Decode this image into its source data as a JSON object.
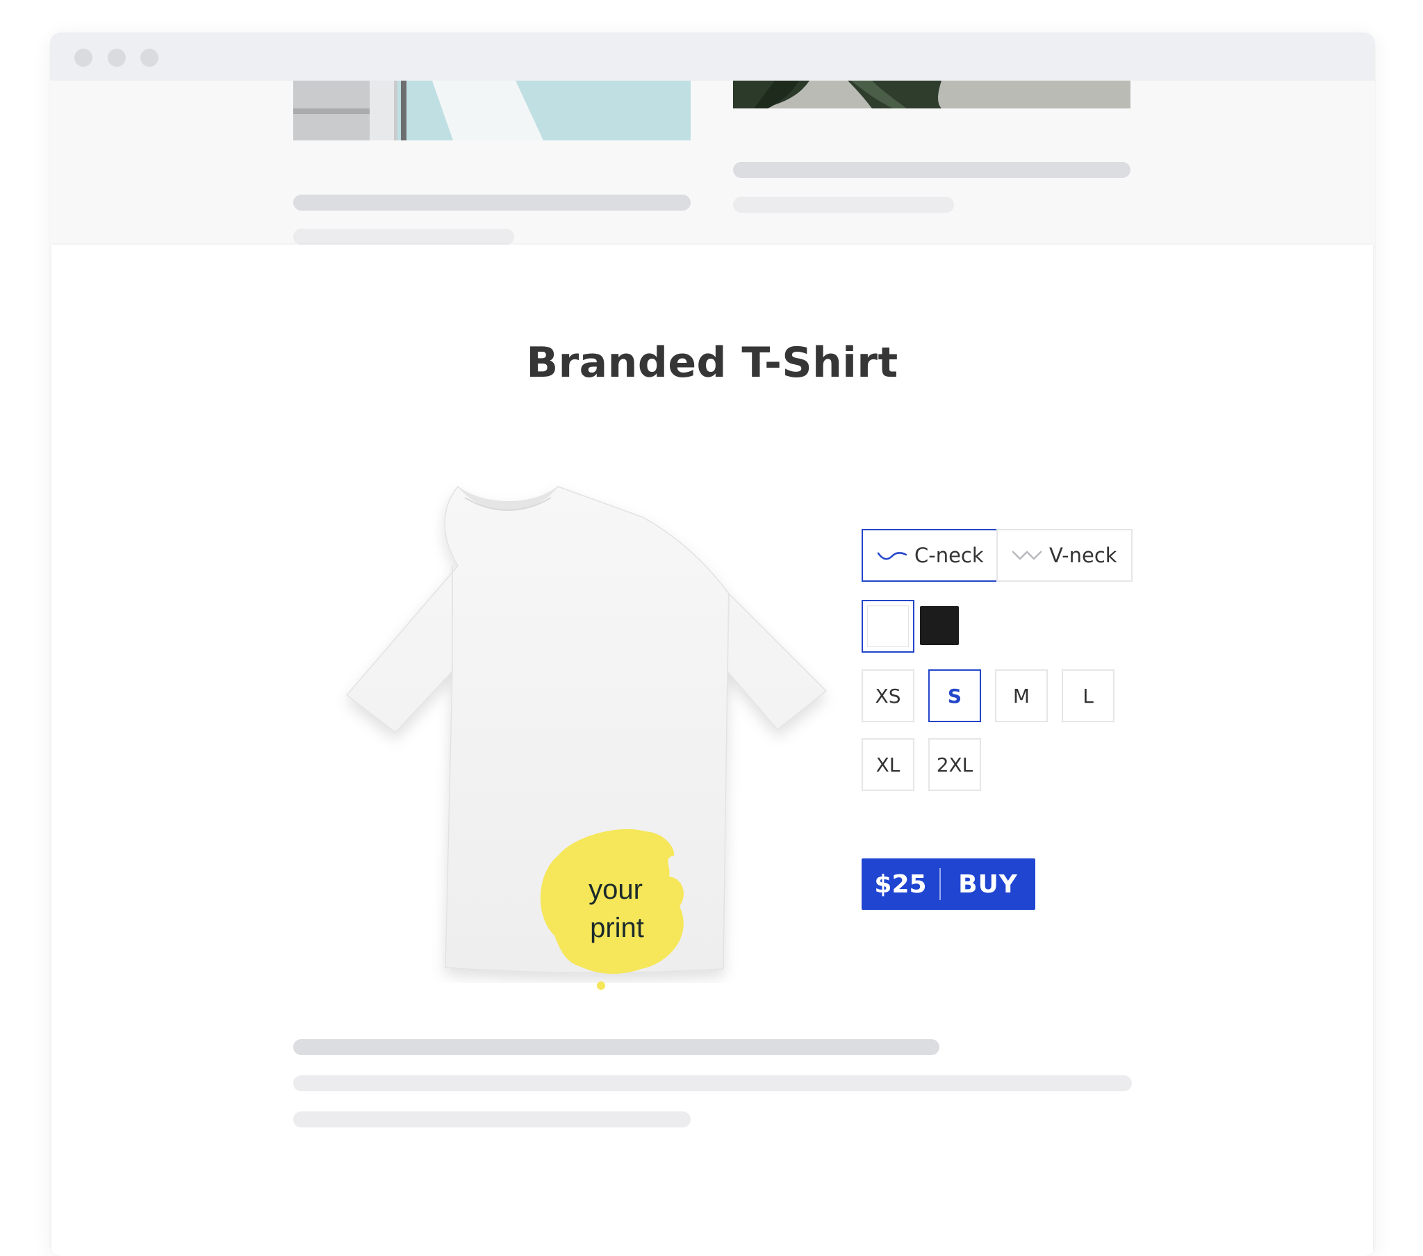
{
  "window": {
    "controls": [
      "close",
      "minimize",
      "maximize"
    ]
  },
  "product": {
    "title": "Branded T-Shirt",
    "print_text_line1": "your",
    "print_text_line2": "print",
    "neck_options": [
      {
        "label": "C-neck",
        "selected": true,
        "icon": "c-neck-wave-icon"
      },
      {
        "label": "V-neck",
        "selected": false,
        "icon": "v-neck-wave-icon"
      }
    ],
    "colors": [
      {
        "name": "white",
        "hex": "#ffffff",
        "selected": true
      },
      {
        "name": "black",
        "hex": "#1c1c1c",
        "selected": false
      }
    ],
    "sizes": [
      {
        "label": "XS",
        "selected": false
      },
      {
        "label": "S",
        "selected": true
      },
      {
        "label": "M",
        "selected": false
      },
      {
        "label": "L",
        "selected": false
      },
      {
        "label": "XL",
        "selected": false
      },
      {
        "label": "2XL",
        "selected": false
      }
    ],
    "buy_button": {
      "price": "$25",
      "label": "BUY"
    }
  },
  "theme": {
    "accent": "#1f45d1",
    "print_color": "#f5e65a",
    "placeholder_dark": "#dcdde0",
    "placeholder_light": "#ececee"
  }
}
